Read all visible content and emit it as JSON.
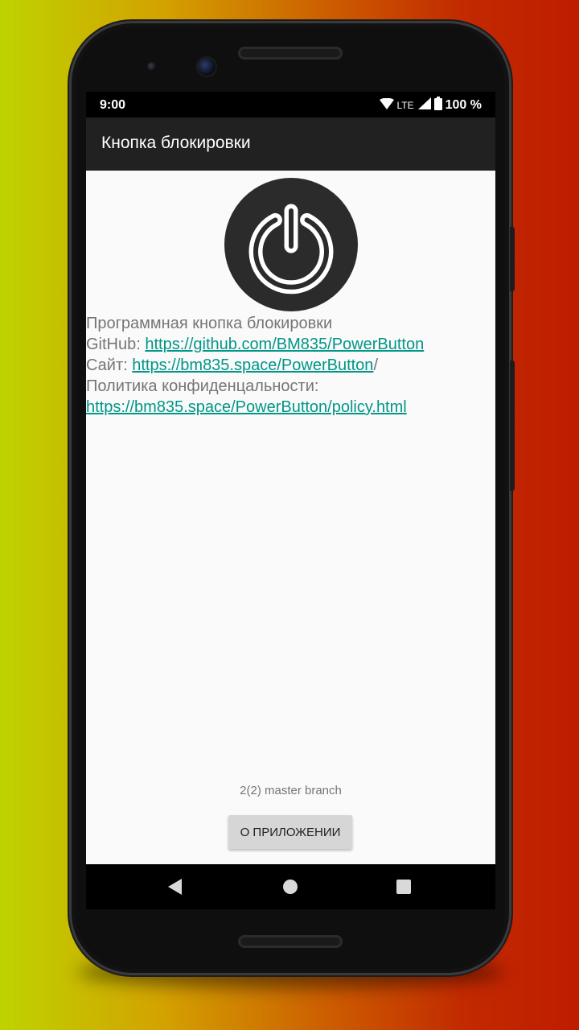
{
  "status_bar": {
    "time": "9:00",
    "network": "LTE",
    "battery": "100 %"
  },
  "app_bar": {
    "title": "Кнопка блокировки"
  },
  "content": {
    "description": "Программная кнопка блокировки",
    "github_label": " GitHub: ",
    "github_url": "https://github.com/BM835/PowerButton",
    "site_label": " Сайт: ",
    "site_url": "https://bm835.space/PowerButton",
    "site_suffix": "/",
    "policy_label": " Политика конфиденцальности:",
    "policy_url": "https://bm835.space/PowerButton/policy.html",
    "version": "2(2) master branch",
    "about_button": "О ПРИЛОЖЕНИИ"
  },
  "icons": {
    "power": "power-icon",
    "wifi": "wifi-icon",
    "signal": "signal-icon",
    "battery": "battery-icon",
    "back": "back-icon",
    "home": "home-icon",
    "recents": "recents-icon"
  },
  "colors": {
    "link": "#009688",
    "app_bar": "#212121",
    "content_bg": "#fafafa",
    "text_secondary": "#757575"
  }
}
